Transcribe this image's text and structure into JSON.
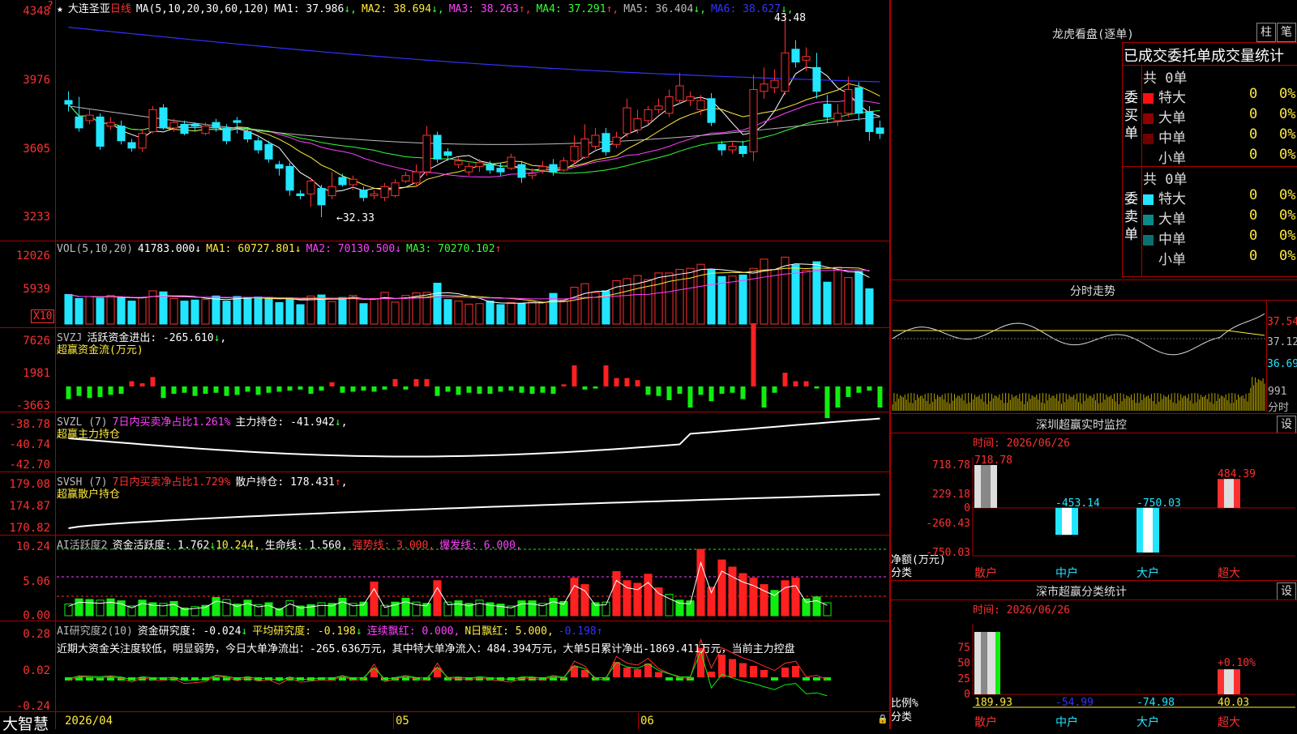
{
  "main": {
    "title": "大连圣亚",
    "period": "日线",
    "ma_label": "MA(5,10,20,30,60,120)",
    "ma": [
      {
        "label": "MA1:",
        "value": "37.986",
        "arrow": "↓",
        "color": "#ffffff"
      },
      {
        "label": "MA2:",
        "value": "38.694",
        "arrow": "↓",
        "color": "#ffeb3b"
      },
      {
        "label": "MA3:",
        "value": "38.263",
        "arrow": "↑",
        "color": "#ff40ff"
      },
      {
        "label": "MA4:",
        "value": "37.291",
        "arrow": "↑",
        "color": "#33ff33"
      },
      {
        "label": "MA5:",
        "value": "36.404",
        "arrow": "↓",
        "color": "#bbbbbb"
      },
      {
        "label": "MA6:",
        "value": "38.627",
        "arrow": "↓",
        "color": "#3333ff"
      }
    ],
    "y_labels": [
      "4348",
      "3976",
      "3605",
      "3233"
    ],
    "high_label": "43.48",
    "low_label": "←32.33",
    "star": "★",
    "question": "?"
  },
  "vol": {
    "header": "VOL(5,10,20)",
    "value": "41783.000",
    "value_arrow": "↓",
    "ma1": "MA1: 60727.801",
    "ma1_arrow": "↓",
    "ma2": "MA2: 70130.500",
    "ma2_arrow": "↓",
    "ma3": "MA3: 70270.102",
    "ma3_arrow": "↑",
    "y_labels": [
      "12026",
      "5939"
    ],
    "unit": "X10"
  },
  "svzj": {
    "header": "SVZJ",
    "text": "活跃资金进出: -265.610",
    "arrow": "↓",
    "comma": ",",
    "sub": "超赢资金流(万元)",
    "y_labels": [
      "7626",
      "1981",
      "-3663"
    ]
  },
  "svzl": {
    "header": "SVZL (7)",
    "text1": "7日内买卖净占比1.261%",
    "text2": "主力持仓: -41.942",
    "arrow": "↓",
    "comma": ",",
    "sub": "超赢主力持仓",
    "y_labels": [
      "-38.78",
      "-40.74",
      "-42.70"
    ]
  },
  "svsh": {
    "header": "SVSH (7)",
    "text1": "7日内买卖净占比1.729%",
    "text2": "散户持仓: 178.431",
    "arrow": "↑",
    "comma": ",",
    "sub": "超赢散户持仓",
    "y_labels": [
      "179.08",
      "174.87",
      "170.82"
    ]
  },
  "ai1": {
    "header": "AI活跃度2",
    "t1": "资金活跃度: 1.762",
    "a1": "↓",
    "t2": "10.244,",
    "t3": "生命线: 1.560,",
    "t4": "强势线: 3.000,",
    "t5": "爆发线: 6.000,",
    "y_labels": [
      "10.24",
      "5.06",
      "0.00"
    ]
  },
  "ai2": {
    "header": "AI研究度2(10)",
    "t1": "资金研究度: -0.024",
    "a1": "↓",
    "t2": "平均研究度: -0.198",
    "a2": "↓",
    "t3": "连续飘红: 0.000,",
    "t4": "N日飘红: 5.000,",
    "t5": "-0.198",
    "a5": "↑",
    "comment": "近期大资金关注度较低，明显弱势，今日大单净流出：-265.636万元，其中特大单净流入：484.394万元，大单5日累计净出-1869.411万元，当前主力控盘",
    "y_labels": [
      "0.28",
      "0.02",
      "-0.24"
    ]
  },
  "xaxis": {
    "labels": [
      "2026/04",
      "05",
      "06"
    ]
  },
  "brand": "大智慧",
  "right": {
    "lhb_title": "龙虎看盘(逐单)",
    "btn1": "柱",
    "btn2": "笔",
    "tabs": "已成交委托单成交量统计",
    "buy_label": "委买单",
    "sell_label": "委卖单",
    "buy_total": "共 0单",
    "sell_total": "共 0单",
    "buy_rows": [
      {
        "name": "特大",
        "count": "0",
        "pct": "0%",
        "color": "#ff1010"
      },
      {
        "name": "大单",
        "count": "0",
        "pct": "0%",
        "color": "#900000"
      },
      {
        "name": "中单",
        "count": "0",
        "pct": "0%",
        "color": "#700000"
      },
      {
        "name": "小单",
        "count": "0",
        "pct": "0%",
        "color": "#000000"
      }
    ],
    "sell_rows": [
      {
        "name": "特大",
        "count": "0",
        "pct": "0%",
        "color": "#22e6ff"
      },
      {
        "name": "大单",
        "count": "0",
        "pct": "0%",
        "color": "#0a8a8a"
      },
      {
        "name": "中单",
        "count": "0",
        "pct": "0%",
        "color": "#0a7070"
      },
      {
        "name": "小单",
        "count": "0",
        "pct": "0%",
        "color": "#000000"
      }
    ],
    "intraday_title": "分时走势",
    "intraday_labels": [
      "37.54",
      "37.12",
      "36.69"
    ],
    "intraday_vol": "991",
    "intraday_vol_unit": "分时",
    "monitor_title": "深圳超赢实时监控",
    "monitor_set": "设",
    "monitor_time": "时间: 2026/06/26",
    "monitor_y": [
      "718.78",
      "229.18",
      "0",
      "-260.43",
      "-750.03"
    ],
    "monitor_unit": "净额(万元)",
    "monitor_cat": "分类",
    "monitor_cats": [
      "散户",
      "中户",
      "大户",
      "超大"
    ],
    "monitor_values": [
      "718.78",
      "-453.14",
      "-750.03",
      "484.39"
    ],
    "stat_title": "深市超赢分类统计",
    "stat_set": "设",
    "stat_time": "时间: 2026/06/26",
    "stat_y": [
      "75",
      "50",
      "25",
      "0"
    ],
    "stat_unit": "比例%",
    "stat_cat": "分类",
    "stat_cats": [
      "散户",
      "中户",
      "大户",
      "超大"
    ],
    "stat_values": [
      "189.93",
      "-54.99",
      "-74.98",
      "40.03"
    ],
    "stat_pct": "+0.10%"
  },
  "chart_data": {
    "type": "bar",
    "title": "深圳超赢实时监控",
    "categories": [
      "散户",
      "中户",
      "大户",
      "超大"
    ],
    "series": [
      {
        "values": [
          718.78,
          -453.14,
          -750.03,
          484.39
        ]
      }
    ],
    "ylabel": "净额(万元)",
    "xlabel": "分类",
    "ylim": [
      -750.03,
      718.78
    ],
    "candles": [
      [
        38.7,
        38.5,
        39.2,
        38.1
      ],
      [
        37.8,
        37.2,
        38.9,
        37.0
      ],
      [
        37.6,
        37.9,
        38.2,
        37.4
      ],
      [
        37.8,
        36.2,
        38.0,
        36.0
      ],
      [
        37.3,
        37.5,
        37.8,
        37.1
      ],
      [
        37.3,
        36.5,
        37.6,
        36.3
      ],
      [
        36.4,
        36.1,
        36.6,
        35.9
      ],
      [
        36.1,
        36.9,
        37.1,
        35.9
      ],
      [
        37.0,
        38.2,
        38.4,
        36.9
      ],
      [
        38.3,
        37.2,
        38.5,
        37.1
      ],
      [
        37.2,
        37.5,
        37.7,
        37.0
      ],
      [
        37.4,
        36.9,
        37.6,
        36.8
      ],
      [
        37.4,
        37.3,
        37.5,
        37.0
      ],
      [
        36.9,
        37.3,
        37.5,
        36.8
      ],
      [
        37.5,
        37.2,
        37.7,
        37.0
      ],
      [
        37.2,
        36.5,
        37.4,
        36.3
      ],
      [
        37.6,
        37.5,
        37.8,
        36.9
      ],
      [
        37.0,
        36.6,
        37.2,
        36.4
      ],
      [
        36.5,
        36.0,
        36.7,
        35.8
      ],
      [
        36.3,
        35.5,
        36.5,
        35.3
      ],
      [
        35.2,
        35.0,
        35.4,
        34.6
      ],
      [
        35.1,
        33.8,
        35.3,
        33.5
      ],
      [
        33.6,
        33.5,
        33.8,
        33.3
      ],
      [
        33.6,
        34.3,
        34.5,
        32.9
      ],
      [
        33.9,
        33.0,
        34.1,
        32.33
      ],
      [
        33.5,
        34.0,
        34.8,
        33.3
      ],
      [
        34.5,
        34.1,
        34.7,
        34.0
      ],
      [
        34.1,
        34.4,
        34.6,
        33.8
      ],
      [
        33.8,
        33.4,
        34.0,
        33.2
      ],
      [
        33.5,
        33.6,
        33.8,
        33.3
      ],
      [
        33.4,
        34.0,
        34.2,
        33.2
      ],
      [
        33.5,
        34.2,
        34.4,
        33.4
      ],
      [
        34.3,
        34.6,
        34.8,
        34.2
      ],
      [
        34.2,
        34.8,
        35.2,
        34.0
      ],
      [
        34.8,
        36.8,
        37.3,
        34.6
      ],
      [
        36.8,
        35.5,
        37.0,
        35.3
      ],
      [
        35.9,
        35.7,
        36.1,
        35.4
      ],
      [
        35.2,
        35.4,
        35.6,
        35.0
      ],
      [
        34.8,
        35.1,
        35.3,
        34.6
      ],
      [
        35.1,
        35.3,
        35.5,
        34.8
      ],
      [
        35.2,
        34.9,
        35.4,
        34.7
      ],
      [
        35.0,
        34.8,
        35.3,
        34.6
      ],
      [
        35.0,
        35.6,
        35.8,
        34.9
      ],
      [
        35.2,
        34.5,
        35.4,
        34.2
      ],
      [
        34.6,
        34.7,
        35.0,
        34.4
      ],
      [
        34.9,
        35.1,
        35.4,
        34.7
      ],
      [
        35.2,
        34.8,
        35.5,
        34.6
      ],
      [
        34.9,
        35.4,
        35.6,
        34.8
      ],
      [
        35.4,
        36.2,
        36.8,
        35.2
      ],
      [
        35.6,
        36.6,
        37.4,
        35.5
      ],
      [
        36.2,
        36.8,
        37.2,
        35.9
      ],
      [
        36.9,
        35.9,
        37.2,
        35.7
      ],
      [
        36.3,
        36.7,
        37.0,
        36.1
      ],
      [
        36.9,
        38.3,
        38.8,
        36.7
      ],
      [
        37.1,
        37.7,
        38.2,
        36.9
      ],
      [
        37.6,
        38.2,
        38.4,
        37.4
      ],
      [
        38.2,
        38.4,
        38.8,
        38.0
      ],
      [
        38.0,
        38.9,
        39.3,
        37.8
      ],
      [
        38.7,
        39.5,
        40.2,
        38.5
      ],
      [
        38.7,
        38.9,
        39.2,
        38.4
      ],
      [
        38.2,
        38.7,
        39.0,
        37.9
      ],
      [
        38.8,
        37.5,
        39.1,
        37.3
      ],
      [
        36.3,
        36.0,
        36.5,
        35.7
      ],
      [
        36.0,
        36.2,
        36.5,
        35.8
      ],
      [
        36.2,
        35.8,
        36.5,
        35.6
      ],
      [
        35.9,
        39.3,
        40.1,
        35.4
      ],
      [
        39.2,
        39.6,
        40.5,
        38.8
      ],
      [
        39.4,
        39.8,
        40.4,
        39.1
      ],
      [
        39.2,
        41.3,
        43.48,
        39.0
      ],
      [
        41.5,
        40.8,
        42.0,
        40.5
      ],
      [
        40.9,
        41.1,
        41.6,
        40.3
      ],
      [
        40.5,
        39.2,
        41.3,
        38.8
      ],
      [
        38.5,
        37.8,
        39.0,
        37.5
      ],
      [
        37.6,
        38.0,
        38.5,
        37.3
      ],
      [
        38.0,
        39.3,
        40.0,
        37.8
      ],
      [
        39.4,
        38.0,
        39.7,
        37.6
      ],
      [
        38.1,
        37.0,
        38.4,
        36.5
      ],
      [
        37.2,
        36.9,
        37.6,
        36.6
      ]
    ],
    "vol": [
      58,
      50,
      54,
      51,
      56,
      52,
      45,
      52,
      65,
      63,
      50,
      45,
      47,
      48,
      55,
      45,
      54,
      52,
      53,
      52,
      42,
      51,
      38,
      55,
      57,
      44,
      52,
      56,
      40,
      50,
      62,
      43,
      56,
      61,
      62,
      80,
      48,
      45,
      39,
      40,
      45,
      38,
      42,
      40,
      44,
      43,
      60,
      45,
      72,
      79,
      62,
      65,
      85,
      89,
      95,
      87,
      100,
      100,
      107,
      109,
      117,
      106,
      93,
      94,
      96,
      109,
      127,
      107,
      131,
      116,
      105,
      122,
      82,
      111,
      91,
      103,
      69
    ],
    "svzj": [
      -1200,
      -900,
      -1100,
      -1000,
      -800,
      -700,
      500,
      300,
      900,
      -1100,
      -700,
      -600,
      -900,
      -700,
      -600,
      -900,
      -800,
      -500,
      -800,
      -600,
      -500,
      -400,
      -300,
      -700,
      -400,
      400,
      -600,
      -500,
      -400,
      -500,
      -300,
      700,
      -300,
      700,
      700,
      -900,
      -500,
      -800,
      -600,
      -700,
      -700,
      -500,
      -400,
      -600,
      -700,
      -600,
      -700,
      200,
      2000,
      -300,
      -200,
      2000,
      800,
      800,
      600,
      -800,
      -900,
      -1300,
      -700,
      -2000,
      -800,
      -1400,
      -700,
      -600,
      -1200,
      6000,
      -2000,
      -600,
      1300,
      500,
      500,
      -200,
      -3000,
      -2000,
      -1000,
      -600,
      -400,
      -2000,
      -400,
      800,
      -700,
      -600,
      -800,
      -1000,
      -2500,
      -400
    ],
    "ai_active": [
      1.8,
      2.6,
      2.5,
      2.4,
      2.6,
      2.3,
      1.5,
      2.4,
      2.0,
      1.9,
      2.2,
      1.2,
      1.4,
      1.6,
      2.8,
      2.5,
      1.8,
      2.4,
      1.7,
      2.0,
      1.1,
      2.3,
      1.5,
      1.7,
      2.0,
      1.9,
      2.7,
      1.9,
      2.1,
      5.2,
      1.6,
      2.1,
      2.7,
      2.1,
      1.9,
      5.4,
      2.1,
      2.3,
      1.9,
      2.4,
      2.0,
      1.8,
      1.5,
      2.3,
      2.3,
      1.9,
      2.7,
      2.2,
      5.8,
      4.8,
      2.0,
      2.1,
      6.8,
      5.4,
      5.0,
      6.4,
      4.3,
      3.3,
      2.4,
      2.3,
      10.24,
      4.4,
      8.6,
      7.5,
      6.5,
      5.8,
      4.8,
      3.9,
      5.4,
      5.8,
      2.6,
      2.9,
      2.0
    ]
  }
}
